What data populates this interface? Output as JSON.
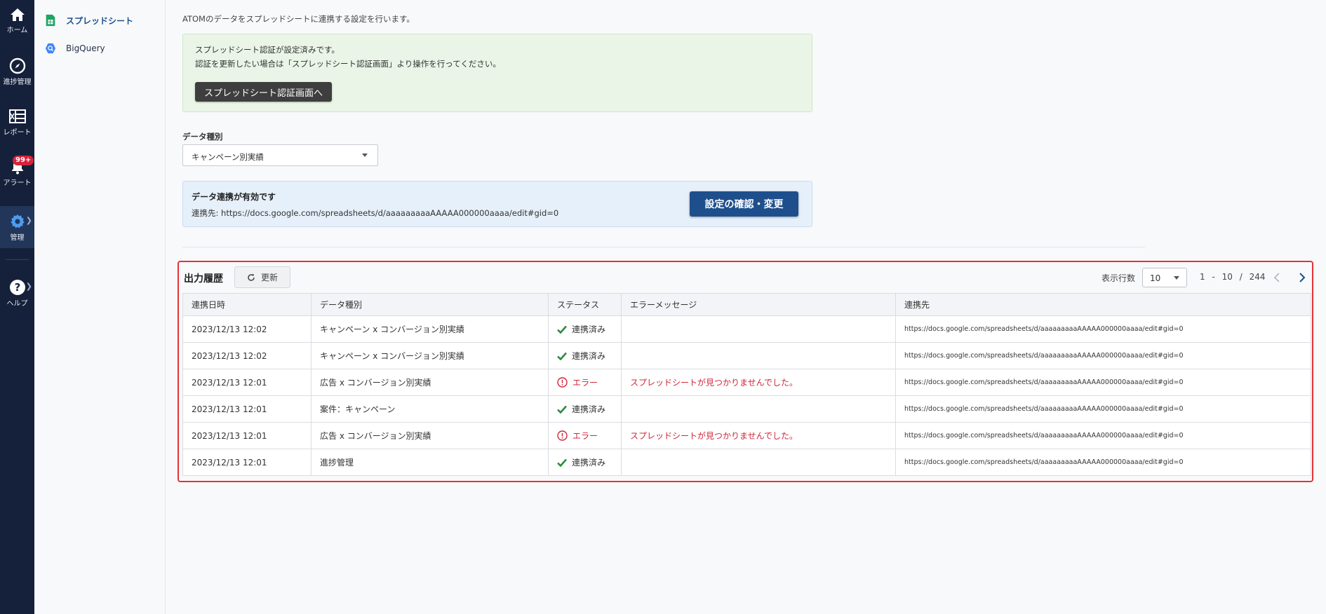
{
  "rail": {
    "items": [
      {
        "label": "ホーム",
        "icon": "home-icon"
      },
      {
        "label": "進捗管理",
        "icon": "compass-icon"
      },
      {
        "label": "レポート",
        "icon": "report-icon"
      },
      {
        "label": "アラート",
        "icon": "bell-icon",
        "badge": "99+"
      },
      {
        "label": "管理",
        "icon": "gear-icon",
        "active": true
      },
      {
        "label": "ヘルプ",
        "icon": "help-icon"
      }
    ]
  },
  "subnav": {
    "items": [
      {
        "label": "スプレッドシート",
        "icon": "spreadsheet-icon",
        "active": true
      },
      {
        "label": "BigQuery",
        "icon": "bigquery-icon"
      }
    ]
  },
  "main": {
    "intro": "ATOMのデータをスプレッドシートに連携する設定を行います。",
    "auth": {
      "line1": "スプレッドシート認証が設定済みです。",
      "line2": "認証を更新したい場合は「スプレッドシート認証画面」より操作を行ってください。",
      "button": "スプレッドシート認証画面へ"
    },
    "data_type": {
      "label": "データ種別",
      "selected": "キャンペーン別実績"
    },
    "link": {
      "title": "データ連携が有効です",
      "url_text": "連携先: https://docs.google.com/spreadsheets/d/aaaaaaaaaAAAAA000000aaaa/edit#gid=0",
      "button": "設定の確認・変更"
    }
  },
  "history": {
    "title": "出力履歴",
    "refresh": "更新",
    "rows_label": "表示行数",
    "rows_value": "10",
    "pager": {
      "from": "1",
      "sep": "-",
      "to": "10",
      "slash": "/",
      "total": "244"
    },
    "columns": [
      "連携日時",
      "データ種別",
      "ステータス",
      "エラーメッセージ",
      "連携先"
    ],
    "rows": [
      {
        "date": "2023/12/13 12:02",
        "type": "キャンペーン x コンバージョン別実績",
        "status": "連携済み",
        "ok": true,
        "error": "",
        "url": "https://docs.google.com/spreadsheets/d/aaaaaaaaaAAAAA000000aaaa/edit#gid=0"
      },
      {
        "date": "2023/12/13 12:02",
        "type": "キャンペーン x コンバージョン別実績",
        "status": "連携済み",
        "ok": true,
        "error": "",
        "url": "https://docs.google.com/spreadsheets/d/aaaaaaaaaAAAAA000000aaaa/edit#gid=0"
      },
      {
        "date": "2023/12/13 12:01",
        "type": "広告 x コンバージョン別実績",
        "status": "エラー",
        "ok": false,
        "error": "スプレッドシートが見つかりませんでした。",
        "url": "https://docs.google.com/spreadsheets/d/aaaaaaaaaAAAAA000000aaaa/edit#gid=0"
      },
      {
        "date": "2023/12/13 12:01",
        "type": "案件：キャンペーン",
        "status": "連携済み",
        "ok": true,
        "error": "",
        "url": "https://docs.google.com/spreadsheets/d/aaaaaaaaaAAAAA000000aaaa/edit#gid=0"
      },
      {
        "date": "2023/12/13 12:01",
        "type": "広告 x コンバージョン別実績",
        "status": "エラー",
        "ok": false,
        "error": "スプレッドシートが見つかりませんでした。",
        "url": "https://docs.google.com/spreadsheets/d/aaaaaaaaaAAAAA000000aaaa/edit#gid=0"
      },
      {
        "date": "2023/12/13 12:01",
        "type": "進捗管理",
        "status": "連携済み",
        "ok": true,
        "error": "",
        "url": "https://docs.google.com/spreadsheets/d/aaaaaaaaaAAAAA000000aaaa/edit#gid=0"
      }
    ]
  },
  "colors": {
    "rail_bg": "#15213a",
    "primary": "#1e4f8c",
    "error": "#d0263a",
    "success": "#2e8b3a",
    "highlight_frame": "#e53238"
  }
}
